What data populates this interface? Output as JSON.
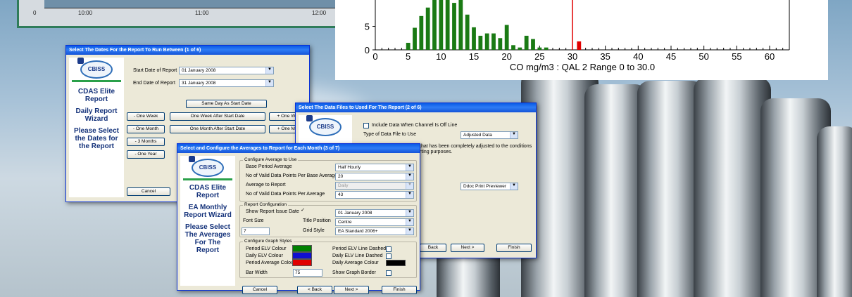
{
  "top_left_chart": {
    "ticks": [
      "0",
      "10:00",
      "11:00",
      "12:00"
    ]
  },
  "top_right_chart": {
    "chart_data": {
      "type": "bar",
      "xlabel": "CO mg/m3 : QAL 2 Range 0 to 30.0",
      "xlim": [
        0,
        63
      ],
      "ylim": [
        0,
        13
      ],
      "x_ticks": [
        "0",
        "5",
        "10",
        "15",
        "20",
        "25",
        "30",
        "35",
        "40",
        "45",
        "50",
        "55",
        "60"
      ],
      "y_ticks": [
        "0",
        "5"
      ],
      "series": [
        {
          "color": "#1a7a14",
          "x": [
            5,
            6,
            7,
            8,
            9,
            10,
            11,
            12,
            13,
            14,
            15,
            16,
            17,
            18,
            19,
            20,
            21,
            22,
            23,
            24,
            25,
            26
          ],
          "values": [
            1.5,
            4.7,
            7.2,
            9,
            12,
            14,
            12,
            10,
            11,
            7.5,
            4.8,
            3,
            3.5,
            3.5,
            2.5,
            5.3,
            1,
            0.5,
            3,
            2.3,
            0.5,
            0.5
          ]
        },
        {
          "color": "#e00000",
          "x": [
            31
          ],
          "values": [
            1.8
          ]
        }
      ],
      "threshold_x": 30,
      "threshold_color": "#e00000"
    }
  },
  "win1": {
    "title": "Select The Dates For the Report To Run Between (1 of 6)",
    "logo": "CBISS",
    "side": [
      "CDAS Elite",
      "Report",
      "",
      "Daily Report",
      "Wizard",
      "",
      "Please Select",
      "the Dates for",
      "the Report"
    ],
    "start_label": "Start Date of Report",
    "start_value": "01  January  2008",
    "end_label": "End Date of Report",
    "end_value": "31  January  2008",
    "same_day": "Same Day As Start Date",
    "buttons": [
      [
        "- One Week",
        "One Week After Start Date",
        "+ One Wee"
      ],
      [
        "- One Month",
        "One Month After Start Date",
        "+ One Mon"
      ],
      [
        "- 3 Months",
        "",
        ""
      ],
      [
        "- One Year",
        "",
        ""
      ]
    ],
    "cancel": "Cancel"
  },
  "win2": {
    "title": "Select The Data Files to Used For The Report (2 of 6)",
    "logo": "CBISS",
    "include_label": "Include Data When Channel Is Off Line",
    "type_label": "Type of Data File to Use",
    "type_value": "Adjusted Data",
    "desc1": "that has been completely adjusted to the conditions",
    "desc2": "rting purposes.",
    "printer_value": "Ddoc Print Previewer",
    "back": "Back",
    "next": "Next >",
    "finish": "Finish"
  },
  "win3": {
    "title": "Select and Configure the Averages to Report for Each Month (3 of 7)",
    "logo": "CBISS",
    "side": [
      "CDAS Elite",
      "Report",
      "",
      "EA Monthly",
      "Report Wizard",
      "",
      "Please Select",
      "The Averages",
      "For The",
      "Report"
    ],
    "g1": "Configure Average to Use",
    "base_label": "Base Period Average",
    "base_value": "Half Hourly",
    "valid_base_label": "No of Valid Data Points Per Base Average",
    "valid_base_value": "20",
    "avg_label": "Average to Report",
    "avg_value": "Daily",
    "valid_avg_label": "No of Valid Data Points Per Average",
    "valid_avg_value": "43",
    "g2": "Report Configuration",
    "issue_label": "Show Report Issue Date",
    "issue_checked": "✓",
    "issue_value": "01  January  2008",
    "font_label": "Font Size",
    "font_value": "7",
    "title_pos_label": "Title Position",
    "title_pos_value": "Centre",
    "grid_label": "Grid Style",
    "grid_value": "EA Standard 2006+",
    "g3": "Configure Graph Styles",
    "pelv": "Period ELV Colour",
    "delv": "Daily ELV Colour",
    "pavg": "Period Average Colour",
    "pelvd": "Period ELV Line Dashed",
    "delvd": "Daily ELV Line Dashed",
    "davg": "Daily Average Colour",
    "barw_label": "Bar Width",
    "barw_value": "75",
    "border_label": "Show Graph Border",
    "cancel": "Cancel",
    "back": "< Back",
    "next": "Next >",
    "finish": "Finish"
  }
}
